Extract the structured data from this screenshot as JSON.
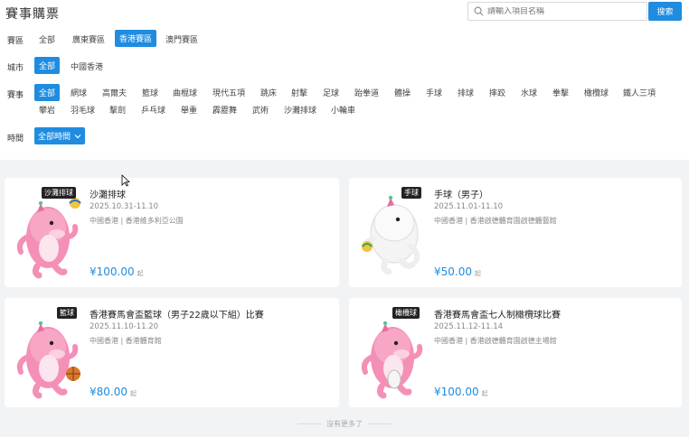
{
  "header": {
    "title": "賽事購票",
    "search_placeholder": "請輸入項目名稱",
    "search_button": "搜索"
  },
  "filters": {
    "region": {
      "label": "賽區",
      "options": [
        "全部",
        "廣東賽區",
        "香港賽區",
        "澳門賽區"
      ],
      "active": "香港賽區"
    },
    "city": {
      "label": "城市",
      "options": [
        "全部",
        "中國香港"
      ],
      "active": "全部"
    },
    "sport": {
      "label": "賽事",
      "row1": [
        "全部",
        "網球",
        "高爾夫",
        "籃球",
        "曲棍球",
        "現代五項",
        "跳床",
        "射擊",
        "足球",
        "跆拳道",
        "體操",
        "手球",
        "排球",
        "摔跤",
        "水球",
        "拳擊",
        "橄欖球",
        "鐵人三項"
      ],
      "row2": [
        "攀岩",
        "羽毛球",
        "擊劍",
        "乒乓球",
        "舉重",
        "霹靂舞",
        "武術",
        "沙灘排球",
        "小輪車"
      ],
      "active": "全部"
    },
    "time": {
      "label": "時間",
      "value": "全部時間",
      "icon": "chevron-down-icon"
    }
  },
  "events": [
    {
      "tag": "沙灘排球",
      "title": "沙灘排球",
      "date": "2025.10.31-11.10",
      "venue": "中國香港 | 香港維多利亞公園",
      "price": "¥100.00",
      "price_suffix": "起"
    },
    {
      "tag": "手球",
      "title": "手球（男子）",
      "date": "2025.11.01-11.10",
      "venue": "中國香港 | 香港啟德體育園啟德體藝館",
      "price": "¥50.00",
      "price_suffix": "起"
    },
    {
      "tag": "籃球",
      "title": "香港賽馬會盃籃球（男子22歲以下組）比賽",
      "date": "2025.11.10-11.20",
      "venue": "中國香港 | 香港體育館",
      "price": "¥80.00",
      "price_suffix": "起"
    },
    {
      "tag": "橄欖球",
      "title": "香港賽馬會盃七人制橄欖球比賽",
      "date": "2025.11.12-11.14",
      "venue": "中國香港 | 香港啟德體育園啟德主場館",
      "price": "¥100.00",
      "price_suffix": "起"
    }
  ],
  "footer": {
    "end_text": "沒有更多了"
  },
  "colors": {
    "accent": "#1f8ce0",
    "mascot_pink": "#f48fb7",
    "background": "#f2f3f5"
  }
}
